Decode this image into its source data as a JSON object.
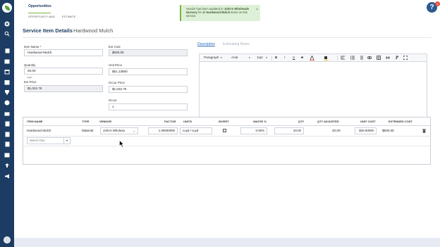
{
  "header": {
    "section_title": "Opportunities",
    "breadcrumb": [
      "OPPORTUNITY #682",
      "ESTIMATE"
    ]
  },
  "toast": {
    "text_before": "Vendor has been updated to ",
    "vendor": "John's Wholesale Nursery",
    "text_middle": " for all ",
    "item": "Hardwood Mulch",
    "text_after": " items on this service.",
    "close": "×"
  },
  "help": {
    "label": "?",
    "badge": "4"
  },
  "page": {
    "title": "Service Item Details",
    "subtitle": "Hardwood Mulch"
  },
  "form": {
    "item_name_label": "Item Name *",
    "item_name_value": "Hardwood Mulch",
    "quantity_label": "Quantity",
    "quantity_value": "20.00",
    "quantity_unit": "cuyd",
    "ext_price_label": "Ext Price",
    "ext_price_value": "$1,022.76",
    "ext_cost_label": "Ext Cost",
    "ext_cost_value": "$500.00",
    "unit_price_label": "Unit Price",
    "unit_price_value": "$51.13800",
    "occur_price_label": "Occur Price",
    "occur_price_value": "$1,022.76",
    "occur_label": "Occur",
    "occur_value": "1"
  },
  "tabs": {
    "description": "Description",
    "estimating_notes": "Estimating Notes"
  },
  "editor": {
    "paragraph": "Paragraph",
    "font": "Arial",
    "size": "11pt",
    "bold": "B",
    "italic": "I",
    "underline": "U",
    "strike": "S"
  },
  "grid": {
    "headers": [
      "ITEM NAME",
      "TYPE",
      "VENDOR",
      "FACTOR",
      "UNITS",
      "INVERT",
      "WASTE %",
      "QTY",
      "QTY ADJUSTED",
      "UNIT COST",
      "EXTENDED COST"
    ],
    "row": {
      "item_name": "Hardwood Mulch",
      "type": "Material",
      "vendor": "John's Wholesa",
      "factor": "1.00000000",
      "units": "cuyd / cuyd",
      "waste": "0.00%",
      "qty": "20.00",
      "qty_adjusted": "20.00",
      "unit_cost": "$25.00000",
      "extended_cost": "$500.00"
    },
    "add_select": "Select One"
  },
  "colors": {
    "navy": "#1d3c63",
    "accent_green": "#7cb342",
    "link_blue": "#2a6dbd"
  }
}
